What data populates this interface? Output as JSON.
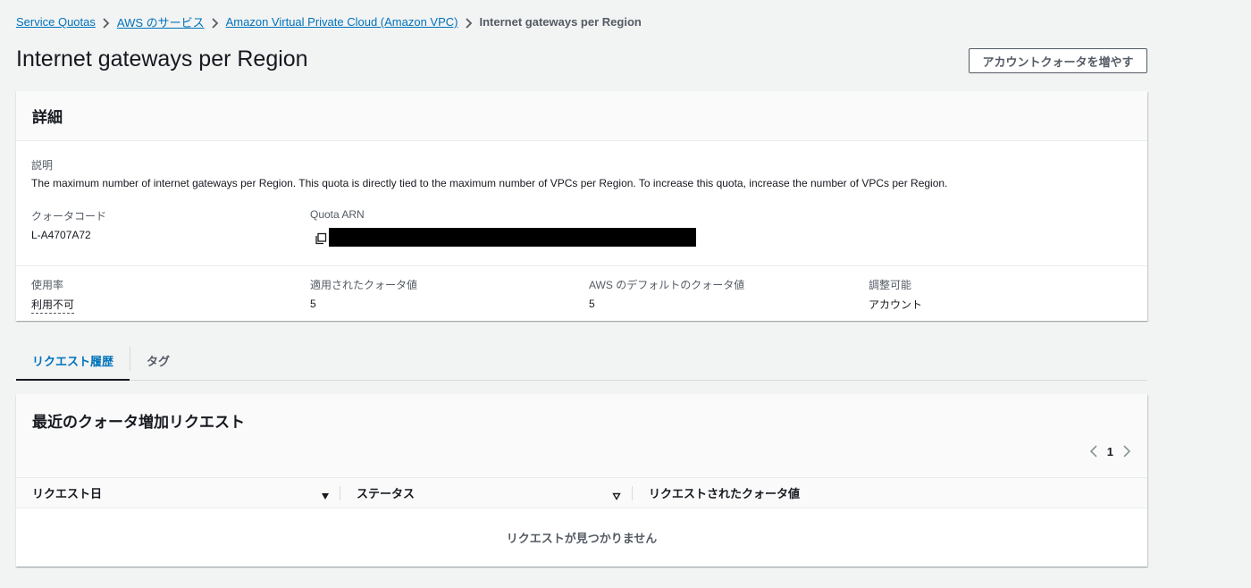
{
  "breadcrumb": {
    "items": [
      "Service Quotas",
      "AWS のサービス",
      "Amazon Virtual Private Cloud (Amazon VPC)"
    ],
    "current": "Internet gateways per Region"
  },
  "page": {
    "title": "Internet gateways per Region",
    "increase_button": "アカウントクォータを増やす"
  },
  "details": {
    "header": "詳細",
    "description_label": "説明",
    "description": "The maximum number of internet gateways per Region. This quota is directly tied to the maximum number of VPCs per Region. To increase this quota, increase the number of VPCs per Region.",
    "quota_code_label": "クォータコード",
    "quota_code": "L-A4707A72",
    "quota_arn_label": "Quota ARN",
    "utilization_label": "使用率",
    "utilization": "利用不可",
    "applied_label": "適用されたクォータ値",
    "applied": "5",
    "default_label": "AWS のデフォルトのクォータ値",
    "default": "5",
    "adjustable_label": "調整可能",
    "adjustable": "アカウント"
  },
  "tabs": [
    {
      "label": "リクエスト履歴",
      "active": true
    },
    {
      "label": "タグ",
      "active": false
    }
  ],
  "requests": {
    "title": "最近のクォータ増加リクエスト",
    "page": "1",
    "columns": [
      "リクエスト日",
      "ステータス",
      "リクエストされたクォータ値"
    ],
    "empty": "リクエストが見つかりません"
  },
  "colors": {
    "link": "#0073bb",
    "background": "#f2f3f3",
    "text": "#16191f",
    "muted": "#545b64"
  }
}
